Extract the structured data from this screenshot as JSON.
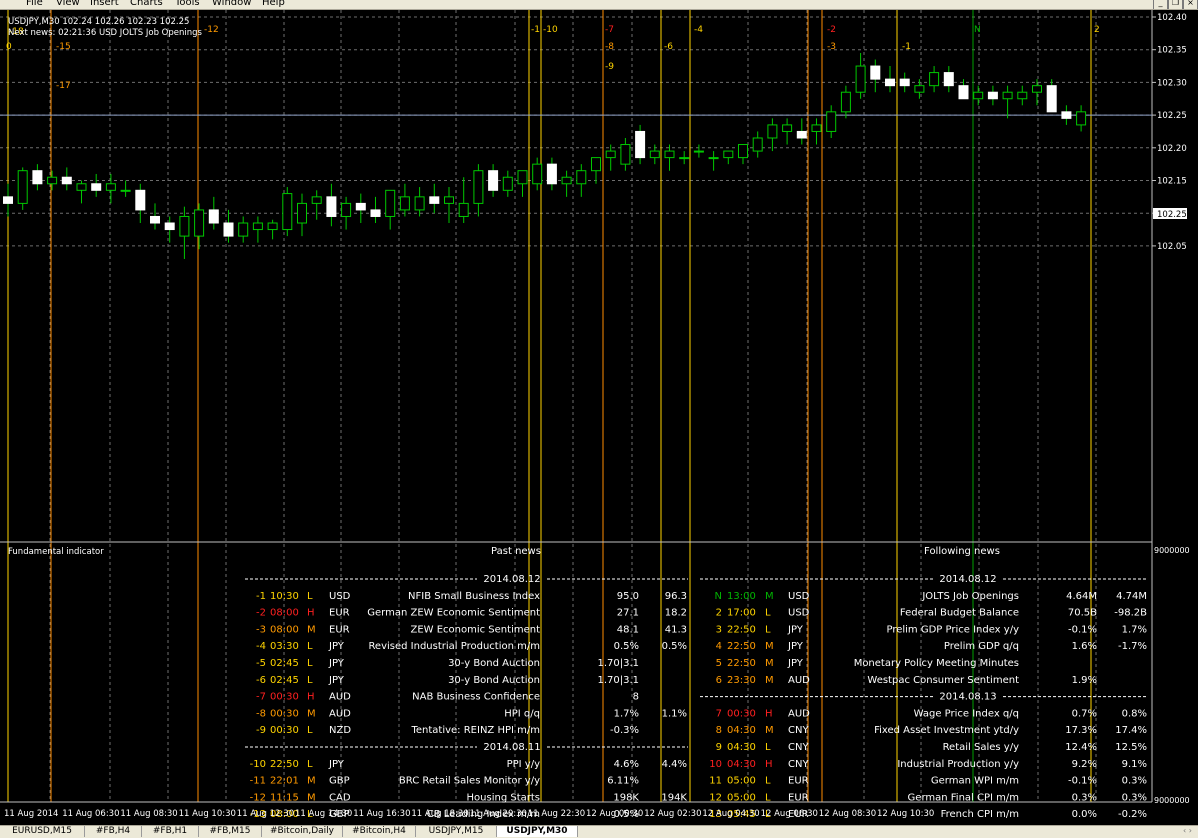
{
  "menu": [
    "File",
    "View",
    "Insert",
    "Charts",
    "Tools",
    "Window",
    "Help"
  ],
  "chart_info": {
    "symbol_line": "USDJPY,M30  102.24 102.26 102.23 102.25",
    "next_news": "Next news: 02:21:36 USD JOLTS Job Openings"
  },
  "colors": {
    "background": "#000000",
    "grid": "#6e6e6e",
    "bull_candle": "#00c800",
    "bear_candle": "#ffffff",
    "news_line_high": "#ff8c00",
    "news_line_medium": "#ffd400",
    "news_line_none": "#00a000",
    "text_red": "#ff2020",
    "text_orange": "#ff9a00",
    "text_yellow": "#ffd400",
    "text_green": "#00b400",
    "text_white": "#ffffff"
  },
  "price_axis": {
    "labels": [
      "102.40",
      "102.35",
      "102.30",
      "102.25",
      "102.20",
      "102.15",
      "102.10",
      "102.05"
    ],
    "current_price": "102.25"
  },
  "indicator": {
    "title": "Fundamental indicator",
    "axis_top": "9000000",
    "axis_bottom": "9000000",
    "past_title": "Past news",
    "following_title": "Following news"
  },
  "time_axis": [
    "11 Aug 2014",
    "11 Aug 06:30",
    "11 Aug 08:30",
    "11 Aug 10:30",
    "11 Aug 12:30",
    "11 Aug 14:30",
    "11 Aug 16:30",
    "11 Aug 18:30",
    "11 Aug 20:30",
    "11 Aug 22:30",
    "12 Aug 00:30",
    "12 Aug 02:30",
    "12 Aug 04:30",
    "12 Aug 06:30",
    "12 Aug 08:30",
    "12 Aug 10:30"
  ],
  "news_markers": [
    {
      "label": "-18",
      "color": "#ffd400"
    },
    {
      "label": "0",
      "color": "#ffd400"
    },
    {
      "label": "-15",
      "color": "#ff9a00"
    },
    {
      "label": "-17",
      "color": "#ff9a00"
    },
    {
      "label": "-12",
      "color": "#ff9a00"
    },
    {
      "label": "-1",
      "color": "#ffd400"
    },
    {
      "label": "-10",
      "color": "#ffd400"
    },
    {
      "label": "-7",
      "color": "#ff2020"
    },
    {
      "label": "-8",
      "color": "#ff9a00"
    },
    {
      "label": "-9",
      "color": "#ffd400"
    },
    {
      "label": "-6",
      "color": "#ffd400"
    },
    {
      "label": "-4",
      "color": "#ffd400"
    },
    {
      "label": "-2",
      "color": "#ff2020"
    },
    {
      "label": "-3",
      "color": "#ff9a00"
    },
    {
      "label": "-1",
      "color": "#ffd400"
    },
    {
      "label": "N",
      "color": "#00b400"
    },
    {
      "label": "2",
      "color": "#ffd400"
    }
  ],
  "past_news": [
    {
      "type": "date",
      "date": "2014.08.12"
    },
    {
      "n": "-1",
      "time": "10:30",
      "imp": "L",
      "cur": "USD",
      "name": "NFIB Small Business Index",
      "v1": "95.0",
      "v2": "96.3",
      "c": "#ffd400"
    },
    {
      "n": "-2",
      "time": "08:00",
      "imp": "H",
      "cur": "EUR",
      "name": "German ZEW Economic Sentiment",
      "v1": "27.1",
      "v2": "18.2",
      "c": "#ff2020"
    },
    {
      "n": "-3",
      "time": "08:00",
      "imp": "M",
      "cur": "EUR",
      "name": "ZEW Economic Sentiment",
      "v1": "48.1",
      "v2": "41.3",
      "c": "#ff9a00"
    },
    {
      "n": "-4",
      "time": "03:30",
      "imp": "L",
      "cur": "JPY",
      "name": "Revised Industrial Production m/m",
      "v1": "0.5%",
      "v2": "0.5%",
      "c": "#ffd400"
    },
    {
      "n": "-5",
      "time": "02:45",
      "imp": "L",
      "cur": "JPY",
      "name": "30-y Bond Auction",
      "v1": "1.70|3.1",
      "v2": "",
      "c": "#ffd400"
    },
    {
      "n": "-6",
      "time": "02:45",
      "imp": "L",
      "cur": "JPY",
      "name": "30-y Bond Auction",
      "v1": "1.70|3.1",
      "v2": "",
      "c": "#ffd400"
    },
    {
      "n": "-7",
      "time": "00:30",
      "imp": "H",
      "cur": "AUD",
      "name": "NAB Business Confidence",
      "v1": "8",
      "v2": "",
      "c": "#ff2020"
    },
    {
      "n": "-8",
      "time": "00:30",
      "imp": "M",
      "cur": "AUD",
      "name": "HPI q/q",
      "v1": "1.7%",
      "v2": "1.1%",
      "c": "#ff9a00"
    },
    {
      "n": "-9",
      "time": "00:30",
      "imp": "L",
      "cur": "NZD",
      "name": "Tentative: REINZ HPI m/m",
      "v1": "-0.3%",
      "v2": "",
      "c": "#ffd400"
    },
    {
      "type": "date",
      "date": "2014.08.11"
    },
    {
      "n": "-10",
      "time": "22:50",
      "imp": "L",
      "cur": "JPY",
      "name": "PPI y/y",
      "v1": "4.6%",
      "v2": "4.4%",
      "c": "#ffd400"
    },
    {
      "n": "-11",
      "time": "22:01",
      "imp": "M",
      "cur": "GBP",
      "name": "BRC Retail Sales Monitor y/y",
      "v1": "6.11%",
      "v2": "",
      "c": "#ff9a00"
    },
    {
      "n": "-12",
      "time": "11:15",
      "imp": "M",
      "cur": "CAD",
      "name": "Housing Starts",
      "v1": "198K",
      "v2": "194K",
      "c": "#ff9a00"
    },
    {
      "n": "-13",
      "time": "08:00",
      "imp": "L",
      "cur": "GBP",
      "name": "CB Leading Index m/m",
      "v1": "0.5%",
      "v2": "",
      "c": "#ffd400"
    }
  ],
  "following_news": [
    {
      "type": "date",
      "date": "2014.08.12"
    },
    {
      "n": "N",
      "time": "13:00",
      "imp": "M",
      "cur": "USD",
      "name": "JOLTS Job Openings",
      "v1": "4.64M",
      "v2": "4.74M",
      "c": "#00b400"
    },
    {
      "n": "2",
      "time": "17:00",
      "imp": "L",
      "cur": "USD",
      "name": "Federal Budget Balance",
      "v1": "70.5B",
      "v2": "-98.2B",
      "c": "#ffd400"
    },
    {
      "n": "3",
      "time": "22:50",
      "imp": "L",
      "cur": "JPY",
      "name": "Prelim GDP Price Index y/y",
      "v1": "-0.1%",
      "v2": "1.7%",
      "c": "#ffd400"
    },
    {
      "n": "4",
      "time": "22:50",
      "imp": "M",
      "cur": "JPY",
      "name": "Prelim GDP q/q",
      "v1": "1.6%",
      "v2": "-1.7%",
      "c": "#ff9a00"
    },
    {
      "n": "5",
      "time": "22:50",
      "imp": "M",
      "cur": "JPY",
      "name": "Monetary Policy Meeting Minutes",
      "v1": "",
      "v2": "",
      "c": "#ff9a00"
    },
    {
      "n": "6",
      "time": "23:30",
      "imp": "M",
      "cur": "AUD",
      "name": "Westpac Consumer Sentiment",
      "v1": "1.9%",
      "v2": "",
      "c": "#ff9a00"
    },
    {
      "type": "date",
      "date": "2014.08.13"
    },
    {
      "n": "7",
      "time": "00:30",
      "imp": "H",
      "cur": "AUD",
      "name": "Wage Price Index q/q",
      "v1": "0.7%",
      "v2": "0.8%",
      "c": "#ff2020"
    },
    {
      "n": "8",
      "time": "04:30",
      "imp": "M",
      "cur": "CNY",
      "name": "Fixed Asset Investment ytd/y",
      "v1": "17.3%",
      "v2": "17.4%",
      "c": "#ff9a00"
    },
    {
      "n": "9",
      "time": "04:30",
      "imp": "L",
      "cur": "CNY",
      "name": "Retail Sales y/y",
      "v1": "12.4%",
      "v2": "12.5%",
      "c": "#ffd400"
    },
    {
      "n": "10",
      "time": "04:30",
      "imp": "H",
      "cur": "CNY",
      "name": "Industrial Production y/y",
      "v1": "9.2%",
      "v2": "9.1%",
      "c": "#ff2020"
    },
    {
      "n": "11",
      "time": "05:00",
      "imp": "L",
      "cur": "EUR",
      "name": "German WPI m/m",
      "v1": "-0.1%",
      "v2": "0.3%",
      "c": "#ffd400"
    },
    {
      "n": "12",
      "time": "05:00",
      "imp": "L",
      "cur": "EUR",
      "name": "German Final CPI m/m",
      "v1": "0.3%",
      "v2": "0.3%",
      "c": "#ffd400"
    },
    {
      "n": "13",
      "time": "05:45",
      "imp": "L",
      "cur": "EUR",
      "name": "French CPI m/m",
      "v1": "0.0%",
      "v2": "-0.2%",
      "c": "#ffd400"
    }
  ],
  "tabs": [
    "EURUSD,M15",
    "#FB,H4",
    "#FB,H1",
    "#FB,M15",
    "#Bitcoin,Daily",
    "#Bitcoin,H4",
    "USDJPY,M15",
    "USDJPY,M30"
  ],
  "active_tab": "USDJPY,M30",
  "chart_data": {
    "type": "candlestick",
    "symbol": "USDJPY",
    "timeframe": "M30",
    "y_range": [
      102.0,
      102.4
    ],
    "current": 102.25,
    "candles": [
      [
        102.125,
        102.145,
        102.095,
        102.115
      ],
      [
        102.115,
        102.17,
        102.105,
        102.165
      ],
      [
        102.165,
        102.175,
        102.135,
        102.145
      ],
      [
        102.145,
        102.165,
        102.135,
        102.155
      ],
      [
        102.155,
        102.17,
        102.135,
        102.145
      ],
      [
        102.135,
        102.15,
        102.115,
        102.145
      ],
      [
        102.145,
        102.16,
        102.125,
        102.135
      ],
      [
        102.135,
        102.16,
        102.115,
        102.145
      ],
      [
        102.135,
        102.15,
        102.125,
        102.135
      ],
      [
        102.135,
        102.145,
        102.085,
        102.105
      ],
      [
        102.095,
        102.115,
        102.075,
        102.085
      ],
      [
        102.085,
        102.095,
        102.055,
        102.075
      ],
      [
        102.065,
        102.11,
        102.03,
        102.095
      ],
      [
        102.065,
        102.115,
        102.045,
        102.105
      ],
      [
        102.105,
        102.125,
        102.075,
        102.085
      ],
      [
        102.085,
        102.105,
        102.055,
        102.065
      ],
      [
        102.065,
        102.095,
        102.055,
        102.085
      ],
      [
        102.075,
        102.095,
        102.055,
        102.085
      ],
      [
        102.075,
        102.09,
        102.06,
        102.085
      ],
      [
        102.075,
        102.14,
        102.065,
        102.13
      ],
      [
        102.085,
        102.13,
        102.065,
        102.115
      ],
      [
        102.115,
        102.135,
        102.09,
        102.125
      ],
      [
        102.125,
        102.145,
        102.08,
        102.095
      ],
      [
        102.095,
        102.125,
        102.075,
        102.115
      ],
      [
        102.115,
        102.13,
        102.085,
        102.105
      ],
      [
        102.105,
        102.125,
        102.085,
        102.095
      ],
      [
        102.095,
        102.125,
        102.075,
        102.135
      ],
      [
        102.105,
        102.145,
        102.095,
        102.125
      ],
      [
        102.105,
        102.14,
        102.095,
        102.125
      ],
      [
        102.125,
        102.145,
        102.1,
        102.115
      ],
      [
        102.115,
        102.14,
        102.085,
        102.125
      ],
      [
        102.095,
        102.155,
        102.085,
        102.115
      ],
      [
        102.115,
        102.175,
        102.095,
        102.165
      ],
      [
        102.165,
        102.175,
        102.125,
        102.135
      ],
      [
        102.135,
        102.165,
        102.125,
        102.155
      ],
      [
        102.145,
        102.165,
        102.125,
        102.165
      ],
      [
        102.145,
        102.185,
        102.135,
        102.175
      ],
      [
        102.175,
        102.185,
        102.135,
        102.145
      ],
      [
        102.145,
        102.165,
        102.125,
        102.155
      ],
      [
        102.145,
        102.175,
        102.125,
        102.165
      ],
      [
        102.165,
        102.185,
        102.145,
        102.185
      ],
      [
        102.185,
        102.205,
        102.165,
        102.195
      ],
      [
        102.175,
        102.215,
        102.165,
        102.205
      ],
      [
        102.225,
        102.235,
        102.175,
        102.185
      ],
      [
        102.185,
        102.205,
        102.175,
        102.195
      ],
      [
        102.185,
        102.205,
        102.165,
        102.195
      ],
      [
        102.185,
        102.195,
        102.175,
        102.185
      ],
      [
        102.195,
        102.205,
        102.185,
        102.195
      ],
      [
        102.185,
        102.195,
        102.165,
        102.185
      ],
      [
        102.185,
        102.195,
        102.175,
        102.195
      ],
      [
        102.185,
        102.205,
        102.175,
        102.205
      ],
      [
        102.195,
        102.225,
        102.185,
        102.215
      ],
      [
        102.215,
        102.245,
        102.195,
        102.235
      ],
      [
        102.225,
        102.245,
        102.205,
        102.235
      ],
      [
        102.225,
        102.245,
        102.205,
        102.215
      ],
      [
        102.225,
        102.245,
        102.205,
        102.235
      ],
      [
        102.225,
        102.265,
        102.215,
        102.255
      ],
      [
        102.255,
        102.295,
        102.245,
        102.285
      ],
      [
        102.285,
        102.345,
        102.275,
        102.325
      ],
      [
        102.325,
        102.335,
        102.285,
        102.305
      ],
      [
        102.305,
        102.325,
        102.285,
        102.295
      ],
      [
        102.305,
        102.315,
        102.285,
        102.295
      ],
      [
        102.285,
        102.305,
        102.275,
        102.295
      ],
      [
        102.295,
        102.325,
        102.285,
        102.315
      ],
      [
        102.315,
        102.325,
        102.285,
        102.295
      ],
      [
        102.295,
        102.305,
        102.275,
        102.275
      ],
      [
        102.275,
        102.295,
        102.265,
        102.285
      ],
      [
        102.285,
        102.295,
        102.265,
        102.275
      ],
      [
        102.275,
        102.295,
        102.245,
        102.285
      ],
      [
        102.275,
        102.295,
        102.265,
        102.285
      ],
      [
        102.285,
        102.305,
        102.265,
        102.295
      ],
      [
        102.295,
        102.305,
        102.275,
        102.255
      ],
      [
        102.255,
        102.265,
        102.235,
        102.245
      ],
      [
        102.235,
        102.265,
        102.225,
        102.255
      ]
    ]
  }
}
